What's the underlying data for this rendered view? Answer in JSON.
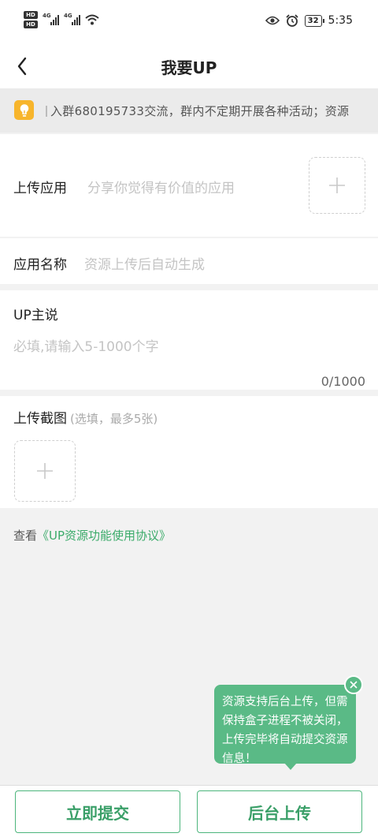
{
  "status_bar": {
    "hd_badges": [
      "HD",
      "HD"
    ],
    "network_labels": [
      "4G",
      "4G"
    ],
    "battery": "32",
    "time": "5:35"
  },
  "header": {
    "title": "我要UP",
    "back_icon": "chevron-left-icon"
  },
  "notice": {
    "icon": "lightbulb-icon",
    "text": "入群680195733交流，群内不定期开展各种活动；资源"
  },
  "form": {
    "upload_app": {
      "label": "上传应用",
      "placeholder": "分享你觉得有价值的应用",
      "add_icon": "plus-icon"
    },
    "app_name": {
      "label": "应用名称",
      "placeholder": "资源上传后自动生成"
    },
    "up_says": {
      "label": "UP主说",
      "placeholder": "必填,请输入5-1000个字",
      "counter": "0/1000"
    },
    "screenshots": {
      "label": "上传截图",
      "sub_hint": "(选填，最多5张)",
      "add_icon": "plus-icon"
    }
  },
  "agreement": {
    "prefix": "查看",
    "link": "《UP资源功能使用协议》"
  },
  "tooltip": {
    "text": "资源支持后台上传，但需保持盒子进程不被关闭，上传完毕将自动提交资源信息！",
    "close_icon": "close-icon"
  },
  "buttons": {
    "submit": "立即提交",
    "background_upload": "后台上传"
  },
  "colors": {
    "accent": "#4cb57c",
    "tooltip_bg": "#5aba86",
    "notice_icon": "#f7b52c"
  }
}
